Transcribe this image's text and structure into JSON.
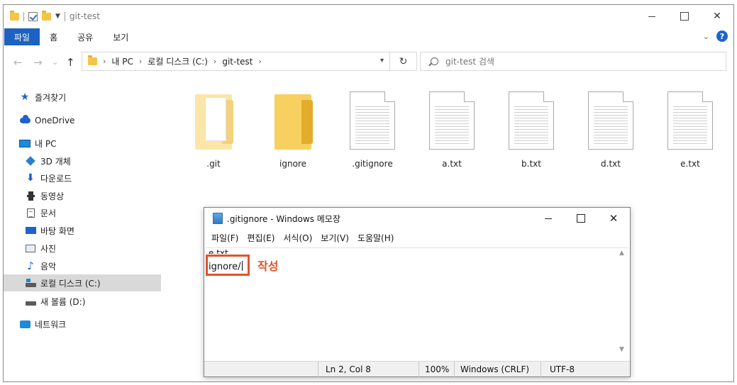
{
  "explorer": {
    "window_title": "git-test",
    "ribbon": {
      "file_tab": "파일",
      "tabs": [
        "홈",
        "공유",
        "보기"
      ],
      "help": "?"
    },
    "nav": {
      "back": "←",
      "forward": "→",
      "recent": "⌄",
      "up": "↑"
    },
    "address": {
      "crumbs": [
        "내 PC",
        "로컬 디스크 (C:)",
        "git-test"
      ],
      "sep": "›"
    },
    "search_placeholder": "git-test 검색",
    "sidebar": {
      "items": [
        {
          "label": "즐겨찾기",
          "icon": "star-icon"
        },
        {
          "label": "OneDrive",
          "icon": "cloud-icon"
        },
        {
          "label": "내 PC",
          "icon": "pc-icon"
        },
        {
          "label": "3D 개체",
          "icon": "cube-icon"
        },
        {
          "label": "다운로드",
          "icon": "download-icon"
        },
        {
          "label": "동영상",
          "icon": "video-icon"
        },
        {
          "label": "문서",
          "icon": "document-icon"
        },
        {
          "label": "바탕 화면",
          "icon": "desktop-icon"
        },
        {
          "label": "사진",
          "icon": "picture-icon"
        },
        {
          "label": "음악",
          "icon": "music-icon"
        },
        {
          "label": "로컬 디스크 (C:)",
          "icon": "drive-icon",
          "selected": true
        },
        {
          "label": "새 볼륨 (D:)",
          "icon": "drive-icon"
        },
        {
          "label": "네트워크",
          "icon": "network-icon"
        }
      ]
    },
    "files": [
      {
        "name": ".git",
        "type": "folder-hidden"
      },
      {
        "name": "ignore",
        "type": "folder"
      },
      {
        "name": ".gitignore",
        "type": "text"
      },
      {
        "name": "a.txt",
        "type": "text"
      },
      {
        "name": "b.txt",
        "type": "text"
      },
      {
        "name": "d.txt",
        "type": "text"
      },
      {
        "name": "e.txt",
        "type": "text"
      }
    ]
  },
  "notepad": {
    "title": ".gitignore - Windows 메모장",
    "menu": [
      "파일(F)",
      "편집(E)",
      "서식(O)",
      "보기(V)",
      "도움말(H)"
    ],
    "line1": "e.txt",
    "line2": "ignore/",
    "callout": "작성",
    "status": {
      "position": "Ln 2, Col 8",
      "zoom": "100%",
      "line_ending": "Windows (CRLF)",
      "encoding": "UTF-8"
    }
  },
  "colors": {
    "accent": "#1d62c0",
    "callout": "#e0532a",
    "folder": "#f7d05f"
  }
}
